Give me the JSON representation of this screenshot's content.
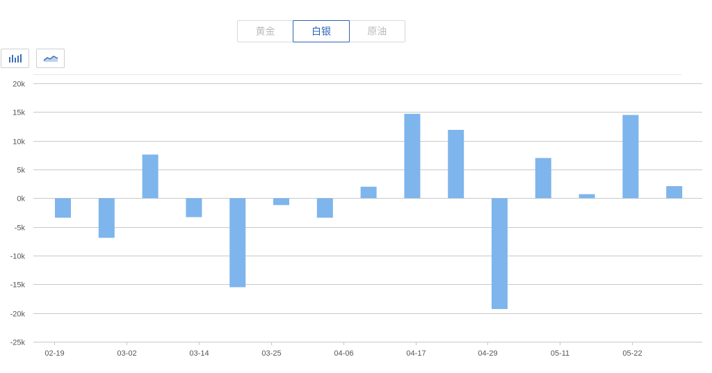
{
  "tabs": [
    {
      "label": "黄金",
      "active": false
    },
    {
      "label": "白银",
      "active": true
    },
    {
      "label": "原油",
      "active": false
    }
  ],
  "toolbar": {
    "bar_view_icon": "bar-chart-icon",
    "line_view_icon": "line-chart-icon"
  },
  "colors": {
    "bar": "#7eb5ec",
    "active_tab": "#2a62b8",
    "grid": "#c8c8c8"
  },
  "chart_data": {
    "type": "bar",
    "title": "",
    "xlabel": "",
    "ylabel": "",
    "ylim": [
      -25000,
      20000
    ],
    "y_ticks": [
      {
        "value": 20000,
        "label": "20k"
      },
      {
        "value": 15000,
        "label": "15k"
      },
      {
        "value": 10000,
        "label": "10k"
      },
      {
        "value": 5000,
        "label": "5k"
      },
      {
        "value": 0,
        "label": "0k"
      },
      {
        "value": -5000,
        "label": "-5k"
      },
      {
        "value": -10000,
        "label": "-10k"
      },
      {
        "value": -15000,
        "label": "-15k"
      },
      {
        "value": -20000,
        "label": "-20k"
      },
      {
        "value": -25000,
        "label": "-25k"
      }
    ],
    "x_tick_labels": [
      "02-19",
      "03-02",
      "03-14",
      "03-25",
      "04-06",
      "04-17",
      "04-29",
      "05-11",
      "05-22"
    ],
    "values": [
      -3400,
      -6900,
      7600,
      -3300,
      -15500,
      -1200,
      -3400,
      2000,
      14700,
      11900,
      -19300,
      7000,
      700,
      14500,
      2100
    ],
    "grid": true,
    "legend": "none"
  }
}
